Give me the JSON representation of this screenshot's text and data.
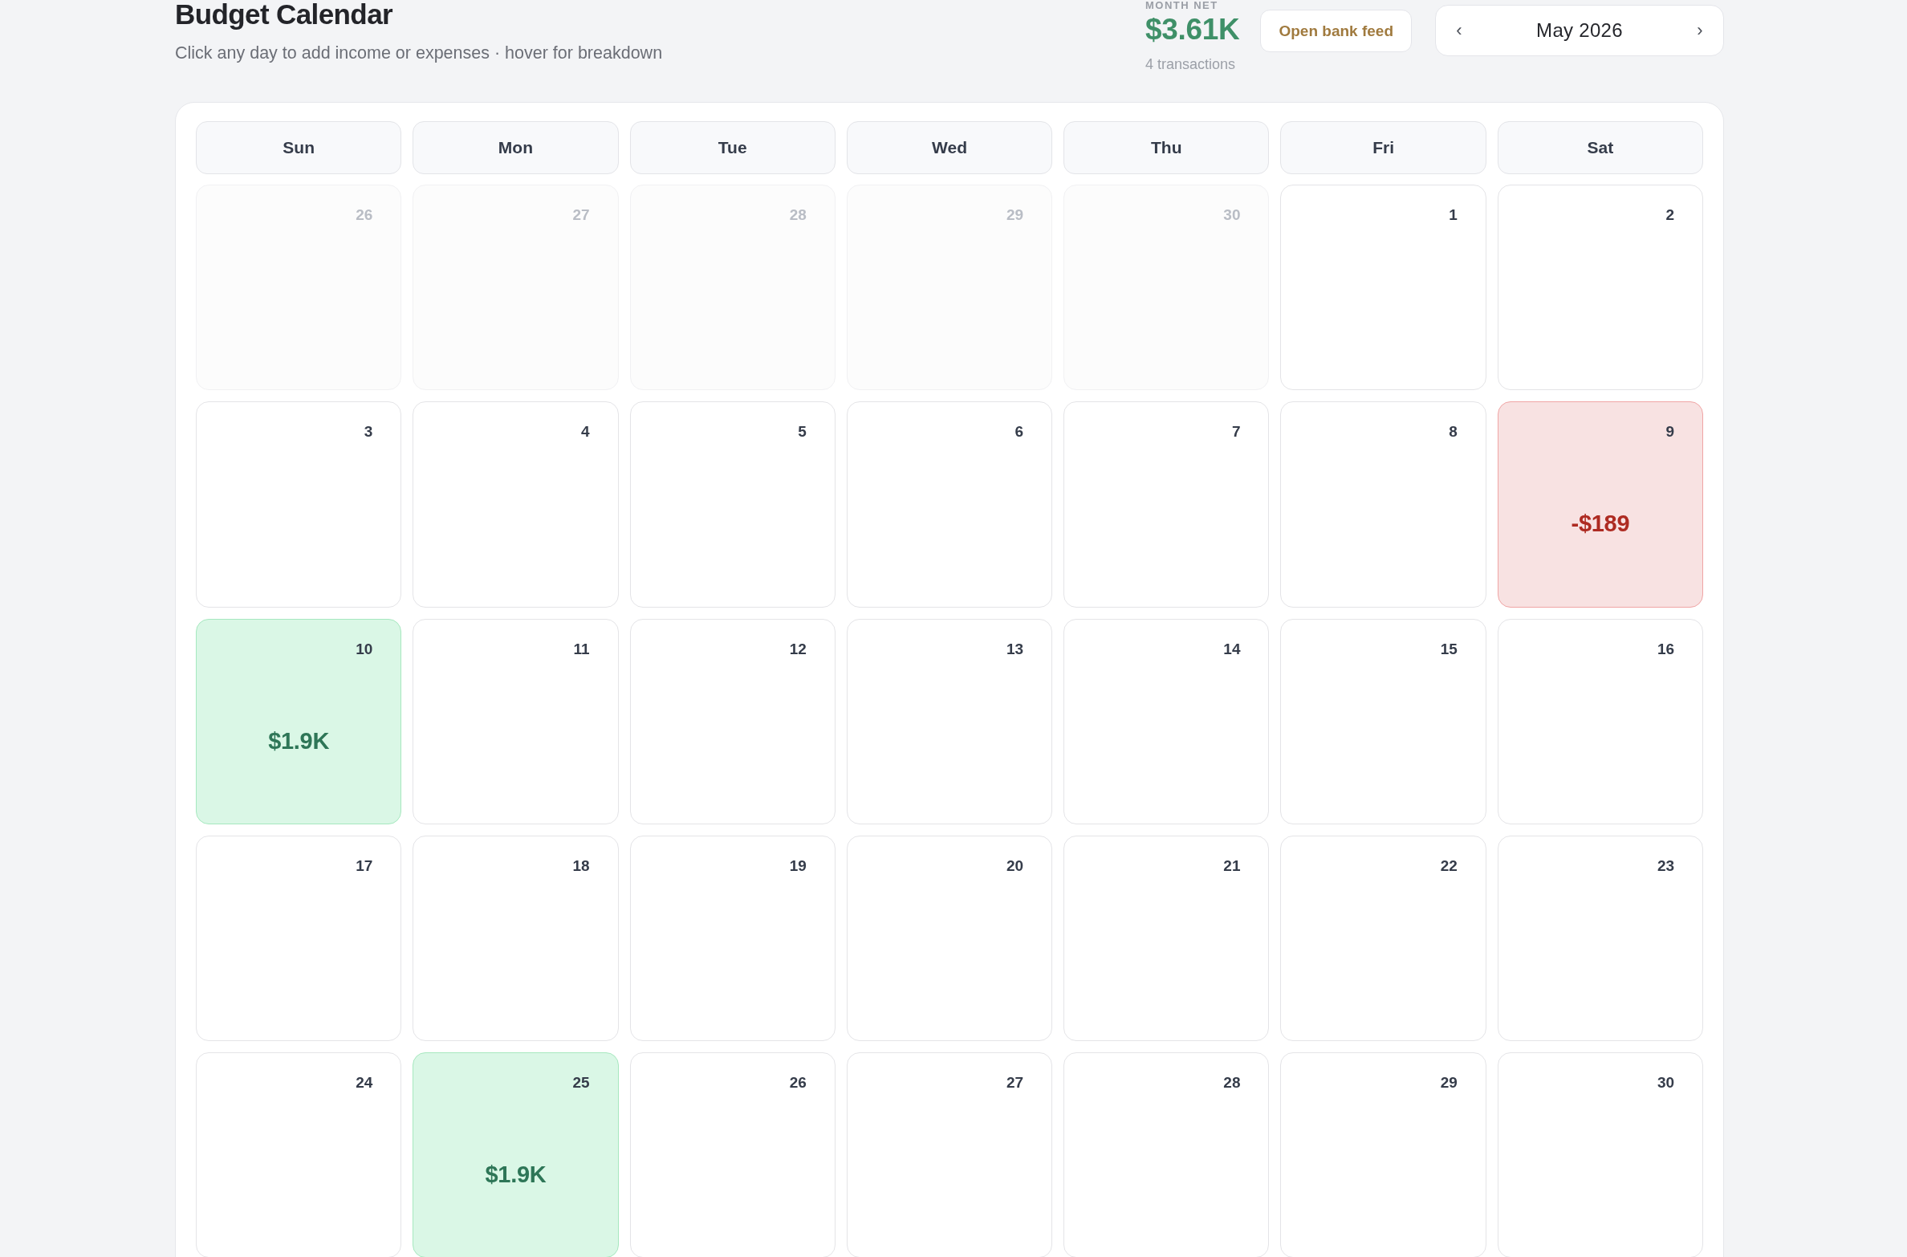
{
  "header": {
    "title": "Budget Calendar",
    "subtitle": "Click any day to add income or expenses · hover for breakdown"
  },
  "summary": {
    "label": "MONTH NET",
    "value": "$3.61K",
    "count": "4 transactions"
  },
  "bank_feed_button": "Open bank feed",
  "month_nav": {
    "prev": "‹",
    "label": "May 2026",
    "next": "›"
  },
  "weekdays": [
    "Sun",
    "Mon",
    "Tue",
    "Wed",
    "Thu",
    "Fri",
    "Sat"
  ],
  "weeks": [
    [
      {
        "day": "26",
        "in_month": false,
        "kind": "plain"
      },
      {
        "day": "27",
        "in_month": false,
        "kind": "plain"
      },
      {
        "day": "28",
        "in_month": false,
        "kind": "plain"
      },
      {
        "day": "29",
        "in_month": false,
        "kind": "plain"
      },
      {
        "day": "30",
        "in_month": false,
        "kind": "plain"
      },
      {
        "day": "1",
        "in_month": true,
        "kind": "plain"
      },
      {
        "day": "2",
        "in_month": true,
        "kind": "plain"
      }
    ],
    [
      {
        "day": "3",
        "in_month": true,
        "kind": "plain"
      },
      {
        "day": "4",
        "in_month": true,
        "kind": "plain"
      },
      {
        "day": "5",
        "in_month": true,
        "kind": "plain"
      },
      {
        "day": "6",
        "in_month": true,
        "kind": "plain"
      },
      {
        "day": "7",
        "in_month": true,
        "kind": "plain"
      },
      {
        "day": "8",
        "in_month": true,
        "kind": "plain"
      },
      {
        "day": "9",
        "in_month": true,
        "kind": "expense",
        "amount": "-$189"
      }
    ],
    [
      {
        "day": "10",
        "in_month": true,
        "kind": "income",
        "amount": "$1.9K"
      },
      {
        "day": "11",
        "in_month": true,
        "kind": "plain"
      },
      {
        "day": "12",
        "in_month": true,
        "kind": "plain"
      },
      {
        "day": "13",
        "in_month": true,
        "kind": "plain"
      },
      {
        "day": "14",
        "in_month": true,
        "kind": "plain"
      },
      {
        "day": "15",
        "in_month": true,
        "kind": "plain"
      },
      {
        "day": "16",
        "in_month": true,
        "kind": "plain"
      }
    ],
    [
      {
        "day": "17",
        "in_month": true,
        "kind": "plain"
      },
      {
        "day": "18",
        "in_month": true,
        "kind": "plain"
      },
      {
        "day": "19",
        "in_month": true,
        "kind": "plain"
      },
      {
        "day": "20",
        "in_month": true,
        "kind": "plain"
      },
      {
        "day": "21",
        "in_month": true,
        "kind": "plain"
      },
      {
        "day": "22",
        "in_month": true,
        "kind": "plain"
      },
      {
        "day": "23",
        "in_month": true,
        "kind": "plain"
      }
    ],
    [
      {
        "day": "24",
        "in_month": true,
        "kind": "plain"
      },
      {
        "day": "25",
        "in_month": true,
        "kind": "income",
        "amount": "$1.9K"
      },
      {
        "day": "26",
        "in_month": true,
        "kind": "plain"
      },
      {
        "day": "27",
        "in_month": true,
        "kind": "plain"
      },
      {
        "day": "28",
        "in_month": true,
        "kind": "plain"
      },
      {
        "day": "29",
        "in_month": true,
        "kind": "plain"
      },
      {
        "day": "30",
        "in_month": true,
        "kind": "plain"
      }
    ]
  ]
}
